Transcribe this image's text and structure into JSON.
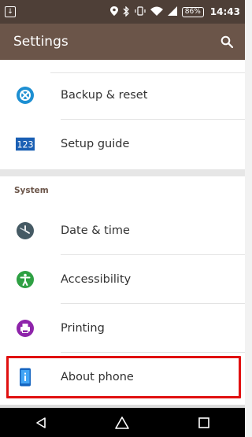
{
  "status_bar": {
    "left_icon": "download-notification-icon",
    "icons": [
      "location-icon",
      "bluetooth-icon",
      "vibrate-icon",
      "wifi-icon",
      "signal-icon"
    ],
    "battery": "86%",
    "time": "14:43"
  },
  "toolbar": {
    "title": "Settings",
    "search_icon": "search-icon"
  },
  "list_top": [
    {
      "label": "Backup & reset",
      "icon": "backup-reset-icon",
      "color": "#1d8fd2"
    },
    {
      "label": "Setup guide",
      "icon": "setup-guide-icon",
      "icon_text": "123",
      "color": "#1a5fb4"
    }
  ],
  "system": {
    "title": "System",
    "items": [
      {
        "label": "Date & time",
        "icon": "clock-icon",
        "color": "#455a64"
      },
      {
        "label": "Accessibility",
        "icon": "accessibility-icon",
        "color": "#2ea043"
      },
      {
        "label": "Printing",
        "icon": "printer-icon",
        "color": "#8e24aa"
      },
      {
        "label": "About phone",
        "icon": "phone-info-icon",
        "color": "#2196f3"
      }
    ]
  },
  "navbar": [
    "back-icon",
    "home-icon",
    "recents-icon"
  ],
  "colors": {
    "status_bar": "#4e3f37",
    "toolbar": "#6b5549",
    "highlight": "#e01010"
  }
}
